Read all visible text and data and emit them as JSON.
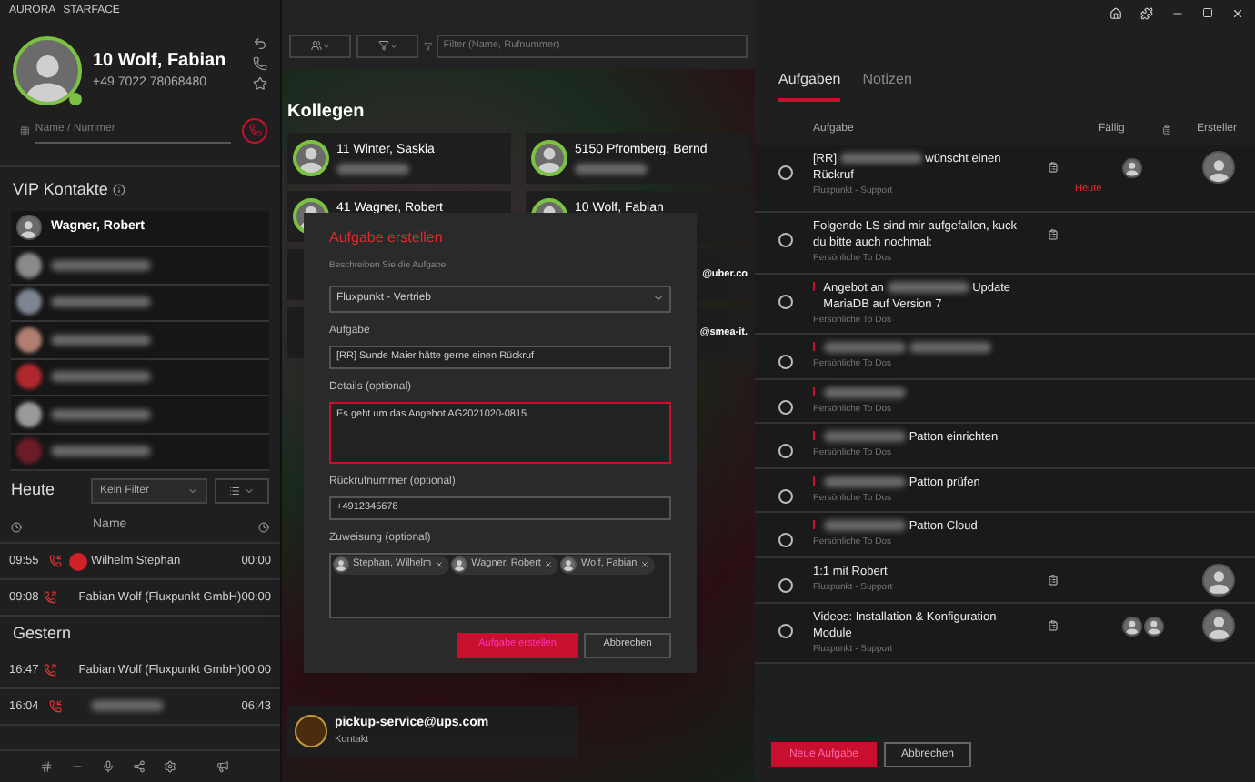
{
  "app_title": [
    "AURORA",
    "STARFACE"
  ],
  "profile": {
    "extension": "10",
    "name": "Wolf, Fabian",
    "phone": "+49 7022 78068480",
    "search_placeholder": "Name / Nummer"
  },
  "vip": {
    "title": "VIP Kontakte",
    "contacts": [
      {
        "kind": "named",
        "name": "Wagner, Robert"
      },
      {
        "kind": "blurred",
        "color": "#8a8a8a"
      },
      {
        "kind": "blurred",
        "color": "#7d8590"
      },
      {
        "kind": "blurred",
        "color": "#b07f72"
      },
      {
        "kind": "blurred",
        "color": "#b0282e"
      },
      {
        "kind": "blurred",
        "color": "#9a9a9a"
      },
      {
        "kind": "blurred",
        "color": "#6e1b28"
      }
    ]
  },
  "calls": {
    "today": "Heute",
    "filter": "Kein Filter",
    "column_name": "Name",
    "today_rows": [
      {
        "time": "09:55",
        "kind": "incoming",
        "avatar": true,
        "name": "Wilhelm Stephan",
        "duration": "00:00"
      },
      {
        "time": "09:08",
        "kind": "outgoing",
        "avatar": false,
        "name": "Fabian Wolf (Fluxpunkt GmbH)",
        "duration": "00:00"
      }
    ],
    "yesterday": "Gestern",
    "yesterday_rows": [
      {
        "time": "16:47",
        "kind": "outgoing",
        "avatar": false,
        "name": "Fabian Wolf (Fluxpunkt GmbH)",
        "duration": "00:00"
      },
      {
        "time": "16:04",
        "kind": "incoming",
        "avatar": false,
        "duration": "06:43"
      }
    ]
  },
  "toolbar": {
    "filter_placeholder": "Filter (Name, Rufnummer)"
  },
  "colleagues": {
    "title": "Kollegen",
    "cards": [
      {
        "name": "11 Winter, Saskia"
      },
      {
        "name": "5150 Pfromberg, Bernd"
      },
      {
        "name": "41 Wagner, Robert"
      },
      {
        "name": "10 Wolf, Fabian"
      }
    ],
    "partial_emails": [
      "@uber.co",
      "@smea-it."
    ],
    "contact": {
      "email": "pickup-service@ups.com",
      "type": "Kontakt"
    }
  },
  "dialog": {
    "title": "Aufgabe erstellen",
    "subtitle": "Beschreiben Sie die Aufgabe",
    "list": "Fluxpunkt - Vertrieb",
    "task_label": "Aufgabe",
    "task": "[RR] Sunde Maier hätte gerne einen Rückruf",
    "details_label": "Details (optional)",
    "details": "Es geht um das Angebot AG2021020-0815",
    "callback_label": "Rückrufnummer (optional)",
    "callback": "+4912345678",
    "assign_label": "Zuweisung (optional)",
    "assignees": [
      "Stephan, Wilhelm",
      "Wagner, Robert",
      "Wolf, Fabian"
    ],
    "submit": "Aufgabe erstellen",
    "cancel": "Abbrechen"
  },
  "tasks": {
    "tabs": [
      {
        "label": "Aufgaben",
        "selected": true
      },
      {
        "label": "Notizen",
        "selected": false
      }
    ],
    "columns": {
      "task": "Aufgabe",
      "due": "Fällig",
      "creator": "Ersteller"
    },
    "rows": [
      {
        "checked": false,
        "priority": false,
        "title": [
          {
            "kind": "text",
            "text": "[RR]"
          },
          {
            "kind": "blurred"
          },
          {
            "kind": "text",
            "text": "wünscht einen Rückruf"
          }
        ],
        "list": "Fluxpunkt - Support",
        "clipboard": true,
        "due": "Heute",
        "assignees": [
          {
            "kind": "photo"
          }
        ],
        "creator": true
      },
      {
        "checked": false,
        "priority": false,
        "title": [
          {
            "kind": "text",
            "text": "Folgende LS sind mir aufgefallen, kuck du bitte auch nochmal:"
          }
        ],
        "list": "Persönliche To Dos",
        "clipboard": true,
        "creator": false
      },
      {
        "checked": false,
        "priority": true,
        "title": [
          {
            "kind": "text",
            "text": "Angebot an"
          },
          {
            "kind": "blurred"
          },
          {
            "kind": "text",
            "text": "Update MariaDB auf Version 7"
          }
        ],
        "list": "Persönliche To Dos",
        "clipboard": false,
        "creator": false
      },
      {
        "checked": false,
        "priority": true,
        "title": [
          {
            "kind": "blurred"
          },
          {
            "kind": "blurred"
          }
        ],
        "list": "Persönliche To Dos",
        "clipboard": false,
        "creator": false
      },
      {
        "checked": false,
        "priority": true,
        "title": [
          {
            "kind": "blurred"
          }
        ],
        "list": "Persönliche To Dos",
        "clipboard": false,
        "creator": false
      },
      {
        "checked": false,
        "priority": true,
        "title": [
          {
            "kind": "blurred"
          },
          {
            "kind": "text",
            "text": "Patton einrichten"
          }
        ],
        "list": "Persönliche To Dos",
        "clipboard": false,
        "creator": false
      },
      {
        "checked": false,
        "priority": true,
        "title": [
          {
            "kind": "blurred"
          },
          {
            "kind": "text",
            "text": "Patton prüfen"
          }
        ],
        "list": "Persönliche To Dos",
        "clipboard": false,
        "creator": false
      },
      {
        "checked": false,
        "priority": true,
        "title": [
          {
            "kind": "blurred"
          },
          {
            "kind": "text",
            "text": "Patton Cloud"
          }
        ],
        "list": "Persönliche To Dos",
        "clipboard": false,
        "creator": false
      },
      {
        "checked": false,
        "priority": false,
        "title": [
          {
            "kind": "text",
            "text": "1:1 mit Robert"
          }
        ],
        "list": "Fluxpunkt - Support",
        "clipboard": true,
        "creator": true
      },
      {
        "checked": false,
        "priority": false,
        "title": [
          {
            "kind": "text",
            "text": "Videos: Installation & Konfiguration Module"
          }
        ],
        "list": "Fluxpunkt - Support",
        "clipboard": true,
        "assignees": [
          {
            "kind": "photo"
          },
          {
            "kind": "photo"
          }
        ],
        "creator": true
      }
    ],
    "new_task": "Neue Aufgabe",
    "cancel": "Abbrechen"
  }
}
